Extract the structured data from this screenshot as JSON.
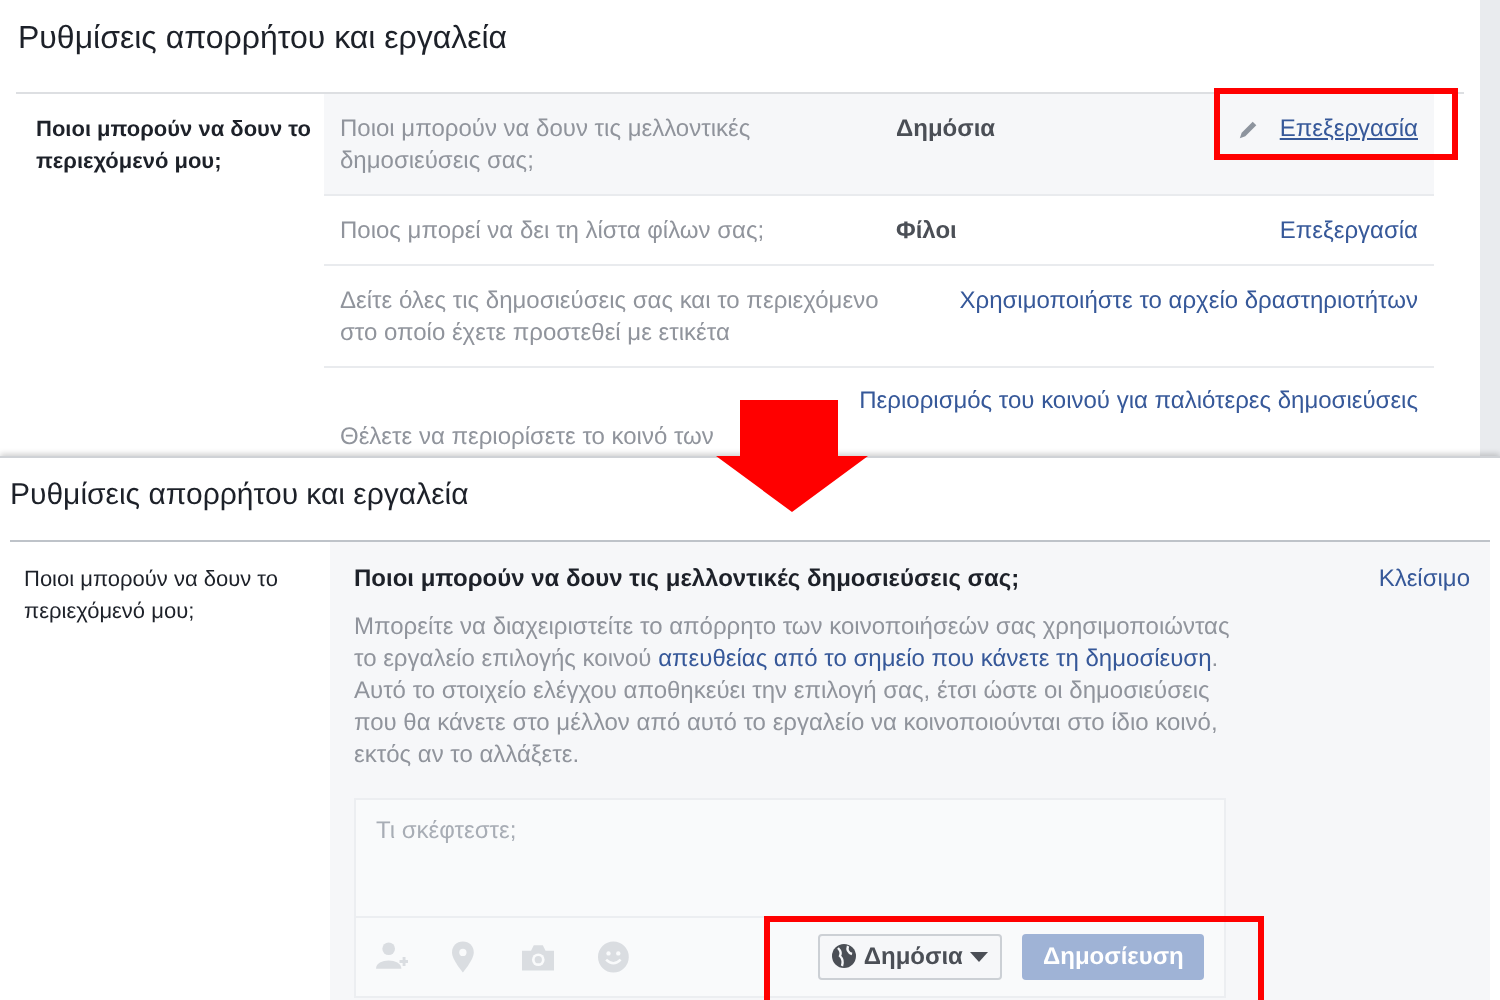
{
  "top_panel": {
    "title": "Ρυθμίσεις απορρήτου και εργαλεία",
    "section_label": "Ποιοι μπορούν να δουν το περιεχόμενό μου;",
    "rows": [
      {
        "question": "Ποιοι μπορούν να δουν τις μελλοντικές δημοσιεύσεις σας;",
        "value": "Δημόσια",
        "action": "Επεξεργασία",
        "hovered": true,
        "callout": true
      },
      {
        "question": "Ποιος μπορεί να δει τη λίστα φίλων σας;",
        "value": "Φίλοι",
        "action": "Επεξεργασία",
        "hovered": false,
        "callout": false
      },
      {
        "question": "Δείτε όλες τις δημοσιεύσεις σας και το περιεχόμενο στο οποίο έχετε προστεθεί με ετικέτα",
        "action": "Χρησιμοποιήστε το αρχείο δραστηριοτήτων",
        "hovered": false,
        "callout": false
      },
      {
        "question": "Θέλετε να περιορίσετε το κοινό των",
        "action": "Περιορισμός του κοινού για παλιότερες δημοσιεύσεις",
        "hovered": false,
        "callout": false
      }
    ]
  },
  "bottom_panel": {
    "title": "Ρυθμίσεις απορρήτου και εργαλεία",
    "section_label": "Ποιοι μπορούν να δουν το περιεχόμενό μου;",
    "heading": "Ποιοι μπορούν να δουν τις μελλοντικές δημοσιεύσεις σας;",
    "close": "Κλείσιμο",
    "description_before": "Μπορείτε να διαχειριστείτε το απόρρητο των κοινοποιήσεών σας χρησιμοποιώντας το εργαλείο επιλογής κοινού ",
    "description_link": "απευθείας από το σημείο που κάνετε τη δημοσίευση",
    "description_after": ". Αυτό το στοιχείο ελέγχου αποθηκεύει την επιλογή σας, έτσι ώστε οι δημοσιεύσεις που θα κάνετε στο μέλλον από αυτό το εργαλείο να κοινοποιούνται στο ίδιο κοινό, εκτός αν το αλλάξετε.",
    "composer": {
      "placeholder": "Τι σκέφτεστε;",
      "audience": "Δημόσια",
      "post_button": "Δημοσίευση",
      "post_disabled": true,
      "callout": true
    }
  }
}
